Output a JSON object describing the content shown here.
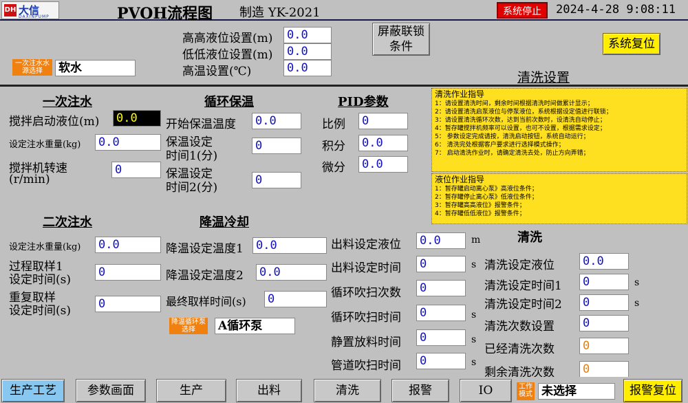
{
  "header": {
    "logo_mark": "DH",
    "logo_name": "大信",
    "logo_en": "DAXINPUMP",
    "title": "PVOH流程图",
    "maker": "制造 YK-2021",
    "status": "系统停止",
    "datetime": "2024-4-28 9:08:11",
    "colors": {
      "status_bg": "#e00000",
      "accent_yellow": "#ffee00",
      "title_blue": "#1a3aa8"
    }
  },
  "top": {
    "water_source_tag": "一次注水水源选择",
    "water_source_value": "软水",
    "hh_level_label": "高高液位设置(m)",
    "hh_level_value": "0.0",
    "ll_level_label": "低低液位设置(m)",
    "ll_level_value": "0.0",
    "high_temp_label": "高温设置(℃)",
    "high_temp_value": "0.0",
    "mask_interlock_btn": "屏蔽联锁条件",
    "system_reset_btn": "系统复位",
    "clean_settings_title": "清洗设置"
  },
  "first_fill": {
    "title": "一次注水",
    "stir_start_level_label": "搅拌启动液位(m)",
    "stir_start_level_value": "0.0",
    "fill_weight_label": "设定注水重量(kg)",
    "fill_weight_value": "0.0",
    "stirrer_speed_label1": "搅拌机转速",
    "stirrer_speed_label2": "(r/min)",
    "stirrer_speed_value": "0"
  },
  "circ_heat": {
    "title": "循环保温",
    "start_temp_label": "开始保温温度",
    "start_temp_value": "0.0",
    "time1_label1": "保温设定",
    "time1_label2": "时间1(分)",
    "time1_value": "0",
    "time2_label1": "保温设定",
    "time2_label2": "时间2(分)",
    "time2_value": "0"
  },
  "pid": {
    "title": "PID参数",
    "p_label": "比例",
    "p_value": "0",
    "i_label": "积分",
    "i_value": "0.0",
    "d_label": "微分",
    "d_value": "0.0"
  },
  "guide_clean": {
    "title": "清洗作业指导",
    "lines": [
      "1：请设置清洗时间，剩余时间根据清洗时间做累计显示；",
      "2：请设置清洗启泵液位与停泵液位，系统根据设定值进行联锁；",
      "3：请设置清洗循环次数，达到当前次数时，设清洗自动停止；",
      "4：暂存罐搅拌机频率可以设置，也可不设置，根据需求设定；",
      "5：  参数设定完成请按，清洗启动按钮，系统自动运行；",
      "6：  清洗完处根据客户要求进行选择模式操作；",
      "7：  启动清洗作业时，请确定清洗去处，防止方向弄错；"
    ]
  },
  "guide_level": {
    "title": "液位作业指导",
    "lines": [
      "1：暂存罐启动离心泵》高液位条件；",
      "2：暂存罐停止离心泵》低液位条件；",
      "3：暂存罐高高液位》报警条件；",
      "4：暂存罐低低液位》报警条件；"
    ]
  },
  "second_fill": {
    "title": "二次注水",
    "fill_weight_label": "设定注水重量(kg)",
    "fill_weight_value": "0.0",
    "sample1_label1": "过程取样1",
    "sample1_label2": "设定时间(s)",
    "sample1_value": "0",
    "repeat_label1": "重复取样",
    "repeat_label2": "设定时间(s)",
    "repeat_value": "0"
  },
  "cooling": {
    "title": "降温冷却",
    "temp1_label": "降温设定温度1",
    "temp1_value": "0.0",
    "temp2_label": "降温设定温度2",
    "temp2_value": "0.0",
    "final_sample_label": "最终取样时间(s)",
    "final_sample_value": "0",
    "pump_tag": "降温循环泵选择",
    "pump_value": "A循环泵"
  },
  "discharge": {
    "level_label": "出料设定液位",
    "level_value": "0.0",
    "level_unit": "m",
    "time_label": "出料设定时间",
    "time_value": "0",
    "time_unit": "s",
    "blow_count_label": "循环吹扫次数",
    "blow_count_value": "0",
    "blow_time_label": "循环吹扫时间",
    "blow_time_value": "0",
    "blow_time_unit": "s",
    "settle_label": "静置放料时间",
    "settle_value": "0",
    "settle_unit": "s",
    "pipe_label": "管道吹扫时间",
    "pipe_value": "0",
    "pipe_unit": "s"
  },
  "clean": {
    "title": "清洗",
    "level_label": "清洗设定液位",
    "level_value": "0.0",
    "time1_label": "清洗设定时间1",
    "time1_value": "0",
    "time1_unit": "s",
    "time2_label": "清洗设定时间2",
    "time2_value": "0",
    "time2_unit": "s",
    "count_label": "清洗次数设置",
    "count_value": "0",
    "done_label": "已经清洗次数",
    "done_value": "0",
    "remain_label": "剩余清洗次数",
    "remain_value": "0"
  },
  "nav": {
    "items": [
      "生产工艺",
      "参数画面",
      "生产",
      "出料",
      "清洗",
      "报警",
      "IO"
    ],
    "mode_tag": "工作模式",
    "mode_value": "未选择",
    "alarm_reset": "报警复位"
  }
}
